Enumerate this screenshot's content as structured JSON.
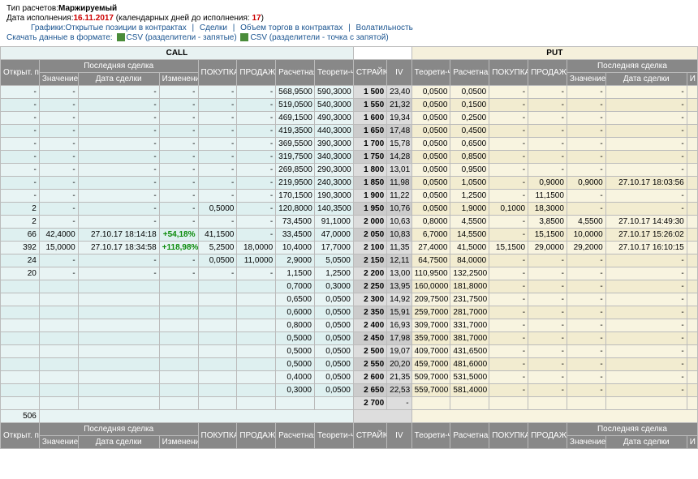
{
  "header": {
    "type_label": "Тип расчетов:",
    "type_value": "Маржируемый",
    "exec_label": "Дата исполнения:",
    "exec_date": "16.11.2017",
    "days_label": "(календарных дней до исполнения:",
    "days_value": "17",
    "days_close": ")",
    "links_label": "Графики:",
    "link1": "Открытые позиции в контрактах",
    "link2": "Сделки",
    "link3": "Объем торгов в контрактах",
    "link4": "Волатильность",
    "download_label": "Скачать данные в формате:",
    "csv1": "CSV (разделители - запятые)",
    "csv2": "CSV (разделители - точка с запятой)"
  },
  "columns": {
    "open_pos": "Открыт. позиций",
    "last_deal": "Последняя сделка",
    "value": "Значение",
    "deal_date": "Дата сделки",
    "change": "Изменение к закрытию",
    "buy": "ПОКУПКА",
    "sell": "ПРОДАЖА",
    "calc_price": "Расчетная цена",
    "theo_price": "Теорети-ческая цена",
    "strike": "СТРАЙК",
    "iv": "IV",
    "ik": "И к",
    "call": "CALL",
    "put": "PUT"
  },
  "rows": [
    {
      "cop": "-",
      "cval": "-",
      "cdate": "-",
      "cchg": "-",
      "cbuy": "-",
      "csell": "-",
      "ccalc": "568,9500",
      "ctheo": "590,3000",
      "strike": "1 500",
      "iv": "23,40",
      "ptheo": "0,0500",
      "pcalc": "0,0500",
      "pbuy": "-",
      "psell": "-",
      "pval": "-",
      "pdate": "-",
      "pop": ""
    },
    {
      "cop": "-",
      "cval": "-",
      "cdate": "-",
      "cchg": "-",
      "cbuy": "-",
      "csell": "-",
      "ccalc": "519,0500",
      "ctheo": "540,3000",
      "strike": "1 550",
      "iv": "21,32",
      "ptheo": "0,0500",
      "pcalc": "0,1500",
      "pbuy": "-",
      "psell": "-",
      "pval": "-",
      "pdate": "-",
      "pop": ""
    },
    {
      "cop": "-",
      "cval": "-",
      "cdate": "-",
      "cchg": "-",
      "cbuy": "-",
      "csell": "-",
      "ccalc": "469,1500",
      "ctheo": "490,3000",
      "strike": "1 600",
      "iv": "19,34",
      "ptheo": "0,0500",
      "pcalc": "0,2500",
      "pbuy": "-",
      "psell": "-",
      "pval": "-",
      "pdate": "-",
      "pop": ""
    },
    {
      "cop": "-",
      "cval": "-",
      "cdate": "-",
      "cchg": "-",
      "cbuy": "-",
      "csell": "-",
      "ccalc": "419,3500",
      "ctheo": "440,3000",
      "strike": "1 650",
      "iv": "17,48",
      "ptheo": "0,0500",
      "pcalc": "0,4500",
      "pbuy": "-",
      "psell": "-",
      "pval": "-",
      "pdate": "-",
      "pop": ""
    },
    {
      "cop": "-",
      "cval": "-",
      "cdate": "-",
      "cchg": "-",
      "cbuy": "-",
      "csell": "-",
      "ccalc": "369,5500",
      "ctheo": "390,3000",
      "strike": "1 700",
      "iv": "15,78",
      "ptheo": "0,0500",
      "pcalc": "0,6500",
      "pbuy": "-",
      "psell": "-",
      "pval": "-",
      "pdate": "-",
      "pop": ""
    },
    {
      "cop": "-",
      "cval": "-",
      "cdate": "-",
      "cchg": "-",
      "cbuy": "-",
      "csell": "-",
      "ccalc": "319,7500",
      "ctheo": "340,3000",
      "strike": "1 750",
      "iv": "14,28",
      "ptheo": "0,0500",
      "pcalc": "0,8500",
      "pbuy": "-",
      "psell": "-",
      "pval": "-",
      "pdate": "-",
      "pop": ""
    },
    {
      "cop": "-",
      "cval": "-",
      "cdate": "-",
      "cchg": "-",
      "cbuy": "-",
      "csell": "-",
      "ccalc": "269,8500",
      "ctheo": "290,3000",
      "strike": "1 800",
      "iv": "13,01",
      "ptheo": "0,0500",
      "pcalc": "0,9500",
      "pbuy": "-",
      "psell": "-",
      "pval": "-",
      "pdate": "-",
      "pop": ""
    },
    {
      "cop": "-",
      "cval": "-",
      "cdate": "-",
      "cchg": "-",
      "cbuy": "-",
      "csell": "-",
      "ccalc": "219,9500",
      "ctheo": "240,3000",
      "strike": "1 850",
      "iv": "11,98",
      "ptheo": "0,0500",
      "pcalc": "1,0500",
      "pbuy": "-",
      "psell": "0,9000",
      "pval": "0,9000",
      "pdate": "27.10.17 18:03:56",
      "pop": ""
    },
    {
      "cop": "-",
      "cval": "-",
      "cdate": "-",
      "cchg": "-",
      "cbuy": "-",
      "csell": "-",
      "ccalc": "170,1500",
      "ctheo": "190,3000",
      "strike": "1 900",
      "iv": "11,22",
      "ptheo": "0,0500",
      "pcalc": "1,2500",
      "pbuy": "-",
      "psell": "11,1500",
      "pval": "-",
      "pdate": "-",
      "pop": ""
    },
    {
      "cop": "2",
      "cval": "-",
      "cdate": "-",
      "cchg": "-",
      "cbuy": "0,5000",
      "csell": "-",
      "ccalc": "120,8000",
      "ctheo": "140,3500",
      "strike": "1 950",
      "iv": "10,76",
      "ptheo": "0,0500",
      "pcalc": "1,9000",
      "pbuy": "0,1000",
      "psell": "18,3000",
      "pval": "-",
      "pdate": "-",
      "pop": ""
    },
    {
      "cop": "2",
      "cval": "-",
      "cdate": "-",
      "cchg": "-",
      "cbuy": "-",
      "csell": "-",
      "ccalc": "73,4500",
      "ctheo": "91,1000",
      "strike": "2 000",
      "iv": "10,63",
      "ptheo": "0,8000",
      "pcalc": "4,5500",
      "pbuy": "-",
      "psell": "3,8500",
      "pval": "4,5500",
      "pdate": "27.10.17 14:49:30",
      "pop": ""
    },
    {
      "cop": "66",
      "cval": "42,4000",
      "cdate": "27.10.17 18:14:18",
      "cchg": "+54,18%",
      "cbuy": "41,1500",
      "csell": "-",
      "ccalc": "33,4500",
      "ctheo": "47,0000",
      "strike": "2 050",
      "iv": "10,83",
      "ptheo": "6,7000",
      "pcalc": "14,5500",
      "pbuy": "-",
      "psell": "15,1500",
      "pval": "10,0000",
      "pdate": "27.10.17 15:26:02",
      "pop": ""
    },
    {
      "cop": "392",
      "cval": "15,0000",
      "cdate": "27.10.17 18:34:58",
      "cchg": "+118,98%",
      "cbuy": "5,2500",
      "csell": "18,0000",
      "ccalc": "10,4000",
      "ctheo": "17,7000",
      "strike": "2 100",
      "iv": "11,35",
      "ptheo": "27,4000",
      "pcalc": "41,5000",
      "pbuy": "15,1500",
      "psell": "29,0000",
      "pval": "29,2000",
      "pdate": "27.10.17 16:10:15",
      "pop": ""
    },
    {
      "cop": "24",
      "cval": "-",
      "cdate": "-",
      "cchg": "-",
      "cbuy": "0,0500",
      "csell": "11,0000",
      "ccalc": "2,9000",
      "ctheo": "5,0500",
      "strike": "2 150",
      "iv": "12,11",
      "ptheo": "64,7500",
      "pcalc": "84,0000",
      "pbuy": "-",
      "psell": "-",
      "pval": "-",
      "pdate": "-",
      "pop": ""
    },
    {
      "cop": "20",
      "cval": "-",
      "cdate": "-",
      "cchg": "-",
      "cbuy": "-",
      "csell": "-",
      "ccalc": "1,1500",
      "ctheo": "1,2500",
      "strike": "2 200",
      "iv": "13,00",
      "ptheo": "110,9500",
      "pcalc": "132,2500",
      "pbuy": "-",
      "psell": "-",
      "pval": "-",
      "pdate": "-",
      "pop": ""
    },
    {
      "cop": "",
      "cval": "",
      "cdate": "",
      "cchg": "",
      "cbuy": "",
      "csell": "",
      "ccalc": "0,7000",
      "ctheo": "0,3000",
      "strike": "2 250",
      "iv": "13,95",
      "ptheo": "160,0000",
      "pcalc": "181,8000",
      "pbuy": "-",
      "psell": "-",
      "pval": "-",
      "pdate": "-",
      "pop": ""
    },
    {
      "cop": "",
      "cval": "",
      "cdate": "",
      "cchg": "",
      "cbuy": "",
      "csell": "",
      "ccalc": "0,6500",
      "ctheo": "0,0500",
      "strike": "2 300",
      "iv": "14,92",
      "ptheo": "209,7500",
      "pcalc": "231,7500",
      "pbuy": "-",
      "psell": "-",
      "pval": "-",
      "pdate": "-",
      "pop": ""
    },
    {
      "cop": "",
      "cval": "",
      "cdate": "",
      "cchg": "",
      "cbuy": "",
      "csell": "",
      "ccalc": "0,6000",
      "ctheo": "0,0500",
      "strike": "2 350",
      "iv": "15,91",
      "ptheo": "259,7000",
      "pcalc": "281,7000",
      "pbuy": "-",
      "psell": "-",
      "pval": "-",
      "pdate": "-",
      "pop": ""
    },
    {
      "cop": "",
      "cval": "",
      "cdate": "",
      "cchg": "",
      "cbuy": "",
      "csell": "",
      "ccalc": "0,8000",
      "ctheo": "0,0500",
      "strike": "2 400",
      "iv": "16,93",
      "ptheo": "309,7000",
      "pcalc": "331,7000",
      "pbuy": "-",
      "psell": "-",
      "pval": "-",
      "pdate": "-",
      "pop": ""
    },
    {
      "cop": "",
      "cval": "",
      "cdate": "",
      "cchg": "",
      "cbuy": "",
      "csell": "",
      "ccalc": "0,5000",
      "ctheo": "0,0500",
      "strike": "2 450",
      "iv": "17,98",
      "ptheo": "359,7000",
      "pcalc": "381,7000",
      "pbuy": "-",
      "psell": "-",
      "pval": "-",
      "pdate": "-",
      "pop": ""
    },
    {
      "cop": "",
      "cval": "",
      "cdate": "",
      "cchg": "",
      "cbuy": "",
      "csell": "",
      "ccalc": "0,5000",
      "ctheo": "0,0500",
      "strike": "2 500",
      "iv": "19,07",
      "ptheo": "409,7000",
      "pcalc": "431,6500",
      "pbuy": "-",
      "psell": "-",
      "pval": "-",
      "pdate": "-",
      "pop": ""
    },
    {
      "cop": "",
      "cval": "",
      "cdate": "",
      "cchg": "",
      "cbuy": "",
      "csell": "",
      "ccalc": "0,5000",
      "ctheo": "0,0500",
      "strike": "2 550",
      "iv": "20,20",
      "ptheo": "459,7000",
      "pcalc": "481,6000",
      "pbuy": "-",
      "psell": "-",
      "pval": "-",
      "pdate": "-",
      "pop": ""
    },
    {
      "cop": "",
      "cval": "",
      "cdate": "",
      "cchg": "",
      "cbuy": "",
      "csell": "",
      "ccalc": "0,4000",
      "ctheo": "0,0500",
      "strike": "2 600",
      "iv": "21,35",
      "ptheo": "509,7000",
      "pcalc": "531,5000",
      "pbuy": "-",
      "psell": "-",
      "pval": "-",
      "pdate": "-",
      "pop": ""
    },
    {
      "cop": "",
      "cval": "",
      "cdate": "",
      "cchg": "",
      "cbuy": "",
      "csell": "",
      "ccalc": "0,3000",
      "ctheo": "0,0500",
      "strike": "2 650",
      "iv": "22,53",
      "ptheo": "559,7000",
      "pcalc": "581,4000",
      "pbuy": "-",
      "psell": "-",
      "pval": "-",
      "pdate": "-",
      "pop": ""
    },
    {
      "cop": "",
      "cval": "",
      "cdate": "",
      "cchg": "",
      "cbuy": "",
      "csell": "",
      "ccalc": "",
      "ctheo": "",
      "strike": "2 700",
      "iv": "-",
      "ptheo": "",
      "pcalc": "",
      "pbuy": "",
      "psell": "",
      "pval": "",
      "pdate": "",
      "pop": ""
    }
  ],
  "footer": {
    "total_open": "506"
  }
}
